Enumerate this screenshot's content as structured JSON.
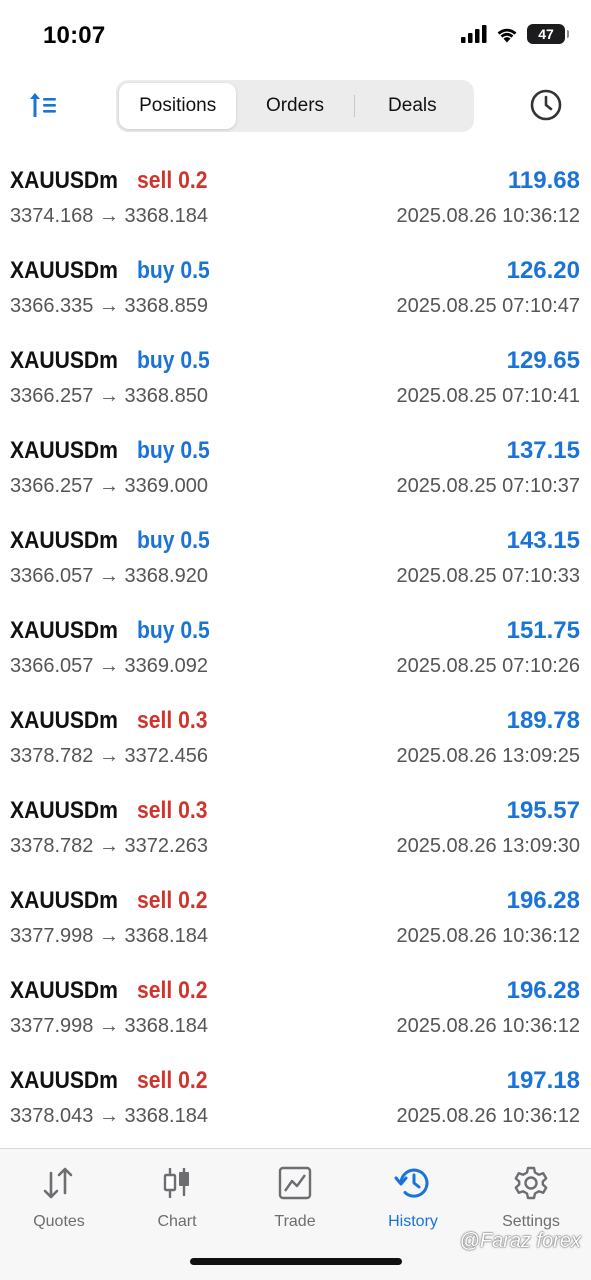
{
  "status_bar": {
    "time": "10:07",
    "battery": "47"
  },
  "header": {
    "tabs": [
      {
        "label": "Positions",
        "active": true
      },
      {
        "label": "Orders",
        "active": false
      },
      {
        "label": "Deals",
        "active": false
      }
    ],
    "sort_icon": "sort-icon",
    "clock_icon": "clock-icon"
  },
  "colors": {
    "sell": "#d0342c",
    "buy": "#1a73d9",
    "profit": "#1a73d9",
    "accent": "#1a73d9"
  },
  "rows": [
    {
      "symbol": "XAUUSDm",
      "side": "sell",
      "volume_text": "sell 0.2",
      "profit": "119.68",
      "prices": "3374.168 → 3368.184",
      "time": "2025.08.26 10:36:12"
    },
    {
      "symbol": "XAUUSDm",
      "side": "buy",
      "volume_text": "buy 0.5",
      "profit": "126.20",
      "prices": "3366.335 → 3368.859",
      "time": "2025.08.25 07:10:47"
    },
    {
      "symbol": "XAUUSDm",
      "side": "buy",
      "volume_text": "buy 0.5",
      "profit": "129.65",
      "prices": "3366.257 → 3368.850",
      "time": "2025.08.25 07:10:41"
    },
    {
      "symbol": "XAUUSDm",
      "side": "buy",
      "volume_text": "buy 0.5",
      "profit": "137.15",
      "prices": "3366.257 → 3369.000",
      "time": "2025.08.25 07:10:37"
    },
    {
      "symbol": "XAUUSDm",
      "side": "buy",
      "volume_text": "buy 0.5",
      "profit": "143.15",
      "prices": "3366.057 → 3368.920",
      "time": "2025.08.25 07:10:33"
    },
    {
      "symbol": "XAUUSDm",
      "side": "buy",
      "volume_text": "buy 0.5",
      "profit": "151.75",
      "prices": "3366.057 → 3369.092",
      "time": "2025.08.25 07:10:26"
    },
    {
      "symbol": "XAUUSDm",
      "side": "sell",
      "volume_text": "sell 0.3",
      "profit": "189.78",
      "prices": "3378.782 → 3372.456",
      "time": "2025.08.26 13:09:25"
    },
    {
      "symbol": "XAUUSDm",
      "side": "sell",
      "volume_text": "sell 0.3",
      "profit": "195.57",
      "prices": "3378.782 → 3372.263",
      "time": "2025.08.26 13:09:30"
    },
    {
      "symbol": "XAUUSDm",
      "side": "sell",
      "volume_text": "sell 0.2",
      "profit": "196.28",
      "prices": "3377.998 → 3368.184",
      "time": "2025.08.26 10:36:12"
    },
    {
      "symbol": "XAUUSDm",
      "side": "sell",
      "volume_text": "sell 0.2",
      "profit": "196.28",
      "prices": "3377.998 → 3368.184",
      "time": "2025.08.26 10:36:12"
    },
    {
      "symbol": "XAUUSDm",
      "side": "sell",
      "volume_text": "sell 0.2",
      "profit": "197.18",
      "prices": "3378.043 → 3368.184",
      "time": "2025.08.26 10:36:12"
    }
  ],
  "tabbar": {
    "items": [
      {
        "label": "Quotes",
        "icon": "quotes-icon",
        "active": false
      },
      {
        "label": "Chart",
        "icon": "chart-icon",
        "active": false
      },
      {
        "label": "Trade",
        "icon": "trade-icon",
        "active": false
      },
      {
        "label": "History",
        "icon": "history-icon",
        "active": true
      },
      {
        "label": "Settings",
        "icon": "settings-icon",
        "active": false
      }
    ]
  },
  "watermark": "@Faraz forex"
}
